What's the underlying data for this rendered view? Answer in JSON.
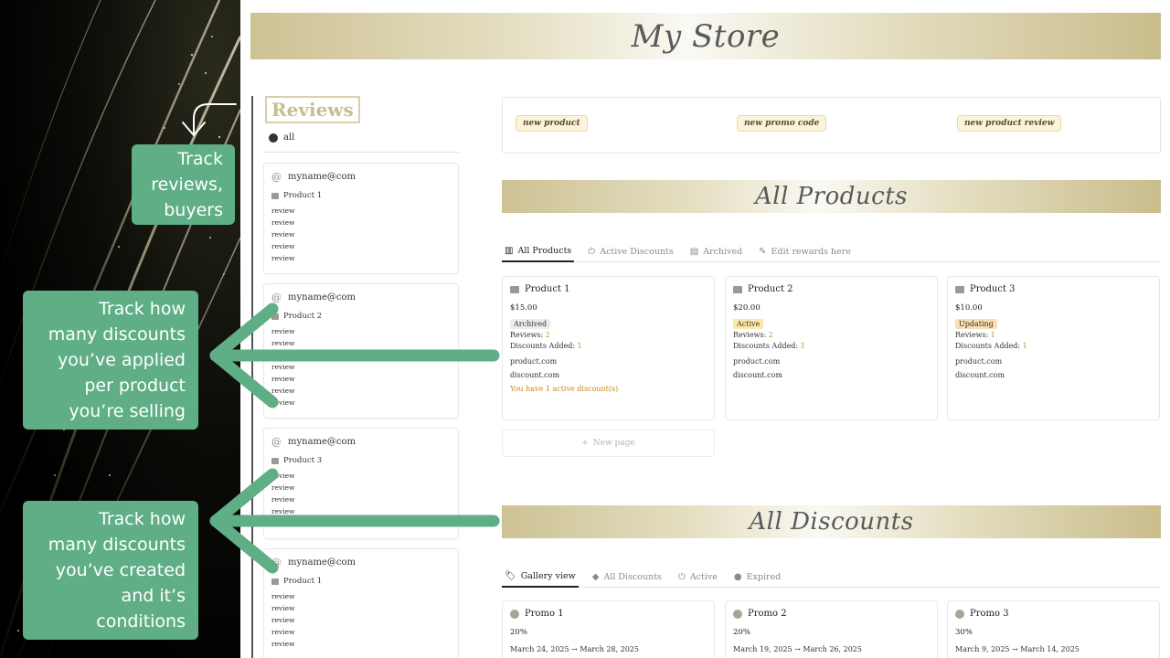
{
  "page": {
    "store_title": "My Store",
    "products_title": "All Products",
    "discounts_title": "All Discounts"
  },
  "reviews": {
    "title": "Reviews",
    "filter_all": "all",
    "cards": [
      {
        "email": "myname@com",
        "product": "Product 1",
        "reviews": [
          "review",
          "review",
          "review",
          "review",
          "review"
        ]
      },
      {
        "email": "myname@com",
        "product": "Product 2",
        "reviews": [
          "review",
          "review",
          "review",
          "review",
          "review",
          "review"
        ]
      },
      {
        "email": "myname@com",
        "product": "Product 3",
        "reviews": [
          "review",
          "review",
          "review",
          "review",
          "review"
        ]
      },
      {
        "email": "myname@com",
        "product": "Product 1",
        "reviews": [
          "review",
          "review",
          "review",
          "review",
          "review"
        ]
      }
    ]
  },
  "quick_actions": {
    "new_product": "new product",
    "new_promo_code": "new promo code",
    "new_product_review": "new product review"
  },
  "product_tabs": {
    "tabs": [
      "All Products",
      "Active Discounts",
      "Archived",
      "Edit rewards here"
    ],
    "active_index": 0
  },
  "products": [
    {
      "name": "Product 1",
      "price": "$15.00",
      "status": "Archived",
      "reviews_label": "Reviews:",
      "reviews_count": "2",
      "discounts_label": "Discounts Added:",
      "discounts_count": "1",
      "product_url": "product.com",
      "discount_url": "discount.com",
      "note": "You have 1 active discount(s)"
    },
    {
      "name": "Product 2",
      "price": "$20.00",
      "status": "Active",
      "reviews_label": "Reviews:",
      "reviews_count": "2",
      "discounts_label": "Discounts Added:",
      "discounts_count": "1",
      "product_url": "product.com",
      "discount_url": "discount.com",
      "note": ""
    },
    {
      "name": "Product 3",
      "price": "$10.00",
      "status": "Updating",
      "reviews_label": "Reviews:",
      "reviews_count": "1",
      "discounts_label": "Discounts Added:",
      "discounts_count": "1",
      "product_url": "product.com",
      "discount_url": "discount.com",
      "note": ""
    }
  ],
  "new_page_label": "New page",
  "discount_tabs": {
    "tabs": [
      "Gallery view",
      "All Discounts",
      "Active",
      "Expired"
    ],
    "active_index": 0
  },
  "promos": [
    {
      "name": "Promo 1",
      "percent": "20%",
      "dates": "March 24, 2025 → March 28, 2025"
    },
    {
      "name": "Promo 2",
      "percent": "20%",
      "dates": "March 19, 2025 → March 26, 2025"
    },
    {
      "name": "Promo 3",
      "percent": "30%",
      "dates": "March 9, 2025 → March 14, 2025"
    }
  ],
  "callouts": {
    "reviews": [
      "Track",
      "reviews,",
      "buyers"
    ],
    "applied": [
      "Track how",
      "many discounts",
      "you’ve applied",
      "per product",
      "you’re selling"
    ],
    "created": [
      "Track how",
      "many discounts",
      "you’ve created",
      "and it’s",
      "conditions"
    ]
  },
  "colors": {
    "callout_green": "#5fae86",
    "accent_gold": "#c8bd8f",
    "count_orange": "#d38a21"
  }
}
